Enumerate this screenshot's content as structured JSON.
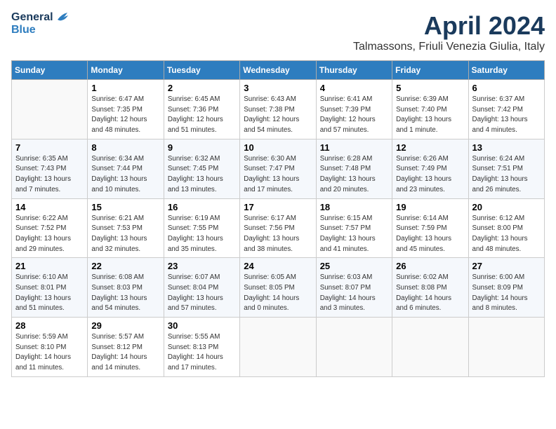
{
  "header": {
    "logo_general": "General",
    "logo_blue": "Blue",
    "month_title": "April 2024",
    "subtitle": "Talmassons, Friuli Venezia Giulia, Italy"
  },
  "days_of_week": [
    "Sunday",
    "Monday",
    "Tuesday",
    "Wednesday",
    "Thursday",
    "Friday",
    "Saturday"
  ],
  "weeks": [
    [
      {
        "day": "",
        "sunrise": "",
        "sunset": "",
        "daylight": ""
      },
      {
        "day": "1",
        "sunrise": "Sunrise: 6:47 AM",
        "sunset": "Sunset: 7:35 PM",
        "daylight": "Daylight: 12 hours and 48 minutes."
      },
      {
        "day": "2",
        "sunrise": "Sunrise: 6:45 AM",
        "sunset": "Sunset: 7:36 PM",
        "daylight": "Daylight: 12 hours and 51 minutes."
      },
      {
        "day": "3",
        "sunrise": "Sunrise: 6:43 AM",
        "sunset": "Sunset: 7:38 PM",
        "daylight": "Daylight: 12 hours and 54 minutes."
      },
      {
        "day": "4",
        "sunrise": "Sunrise: 6:41 AM",
        "sunset": "Sunset: 7:39 PM",
        "daylight": "Daylight: 12 hours and 57 minutes."
      },
      {
        "day": "5",
        "sunrise": "Sunrise: 6:39 AM",
        "sunset": "Sunset: 7:40 PM",
        "daylight": "Daylight: 13 hours and 1 minute."
      },
      {
        "day": "6",
        "sunrise": "Sunrise: 6:37 AM",
        "sunset": "Sunset: 7:42 PM",
        "daylight": "Daylight: 13 hours and 4 minutes."
      }
    ],
    [
      {
        "day": "7",
        "sunrise": "Sunrise: 6:35 AM",
        "sunset": "Sunset: 7:43 PM",
        "daylight": "Daylight: 13 hours and 7 minutes."
      },
      {
        "day": "8",
        "sunrise": "Sunrise: 6:34 AM",
        "sunset": "Sunset: 7:44 PM",
        "daylight": "Daylight: 13 hours and 10 minutes."
      },
      {
        "day": "9",
        "sunrise": "Sunrise: 6:32 AM",
        "sunset": "Sunset: 7:45 PM",
        "daylight": "Daylight: 13 hours and 13 minutes."
      },
      {
        "day": "10",
        "sunrise": "Sunrise: 6:30 AM",
        "sunset": "Sunset: 7:47 PM",
        "daylight": "Daylight: 13 hours and 17 minutes."
      },
      {
        "day": "11",
        "sunrise": "Sunrise: 6:28 AM",
        "sunset": "Sunset: 7:48 PM",
        "daylight": "Daylight: 13 hours and 20 minutes."
      },
      {
        "day": "12",
        "sunrise": "Sunrise: 6:26 AM",
        "sunset": "Sunset: 7:49 PM",
        "daylight": "Daylight: 13 hours and 23 minutes."
      },
      {
        "day": "13",
        "sunrise": "Sunrise: 6:24 AM",
        "sunset": "Sunset: 7:51 PM",
        "daylight": "Daylight: 13 hours and 26 minutes."
      }
    ],
    [
      {
        "day": "14",
        "sunrise": "Sunrise: 6:22 AM",
        "sunset": "Sunset: 7:52 PM",
        "daylight": "Daylight: 13 hours and 29 minutes."
      },
      {
        "day": "15",
        "sunrise": "Sunrise: 6:21 AM",
        "sunset": "Sunset: 7:53 PM",
        "daylight": "Daylight: 13 hours and 32 minutes."
      },
      {
        "day": "16",
        "sunrise": "Sunrise: 6:19 AM",
        "sunset": "Sunset: 7:55 PM",
        "daylight": "Daylight: 13 hours and 35 minutes."
      },
      {
        "day": "17",
        "sunrise": "Sunrise: 6:17 AM",
        "sunset": "Sunset: 7:56 PM",
        "daylight": "Daylight: 13 hours and 38 minutes."
      },
      {
        "day": "18",
        "sunrise": "Sunrise: 6:15 AM",
        "sunset": "Sunset: 7:57 PM",
        "daylight": "Daylight: 13 hours and 41 minutes."
      },
      {
        "day": "19",
        "sunrise": "Sunrise: 6:14 AM",
        "sunset": "Sunset: 7:59 PM",
        "daylight": "Daylight: 13 hours and 45 minutes."
      },
      {
        "day": "20",
        "sunrise": "Sunrise: 6:12 AM",
        "sunset": "Sunset: 8:00 PM",
        "daylight": "Daylight: 13 hours and 48 minutes."
      }
    ],
    [
      {
        "day": "21",
        "sunrise": "Sunrise: 6:10 AM",
        "sunset": "Sunset: 8:01 PM",
        "daylight": "Daylight: 13 hours and 51 minutes."
      },
      {
        "day": "22",
        "sunrise": "Sunrise: 6:08 AM",
        "sunset": "Sunset: 8:03 PM",
        "daylight": "Daylight: 13 hours and 54 minutes."
      },
      {
        "day": "23",
        "sunrise": "Sunrise: 6:07 AM",
        "sunset": "Sunset: 8:04 PM",
        "daylight": "Daylight: 13 hours and 57 minutes."
      },
      {
        "day": "24",
        "sunrise": "Sunrise: 6:05 AM",
        "sunset": "Sunset: 8:05 PM",
        "daylight": "Daylight: 14 hours and 0 minutes."
      },
      {
        "day": "25",
        "sunrise": "Sunrise: 6:03 AM",
        "sunset": "Sunset: 8:07 PM",
        "daylight": "Daylight: 14 hours and 3 minutes."
      },
      {
        "day": "26",
        "sunrise": "Sunrise: 6:02 AM",
        "sunset": "Sunset: 8:08 PM",
        "daylight": "Daylight: 14 hours and 6 minutes."
      },
      {
        "day": "27",
        "sunrise": "Sunrise: 6:00 AM",
        "sunset": "Sunset: 8:09 PM",
        "daylight": "Daylight: 14 hours and 8 minutes."
      }
    ],
    [
      {
        "day": "28",
        "sunrise": "Sunrise: 5:59 AM",
        "sunset": "Sunset: 8:10 PM",
        "daylight": "Daylight: 14 hours and 11 minutes."
      },
      {
        "day": "29",
        "sunrise": "Sunrise: 5:57 AM",
        "sunset": "Sunset: 8:12 PM",
        "daylight": "Daylight: 14 hours and 14 minutes."
      },
      {
        "day": "30",
        "sunrise": "Sunrise: 5:55 AM",
        "sunset": "Sunset: 8:13 PM",
        "daylight": "Daylight: 14 hours and 17 minutes."
      },
      {
        "day": "",
        "sunrise": "",
        "sunset": "",
        "daylight": ""
      },
      {
        "day": "",
        "sunrise": "",
        "sunset": "",
        "daylight": ""
      },
      {
        "day": "",
        "sunrise": "",
        "sunset": "",
        "daylight": ""
      },
      {
        "day": "",
        "sunrise": "",
        "sunset": "",
        "daylight": ""
      }
    ]
  ]
}
